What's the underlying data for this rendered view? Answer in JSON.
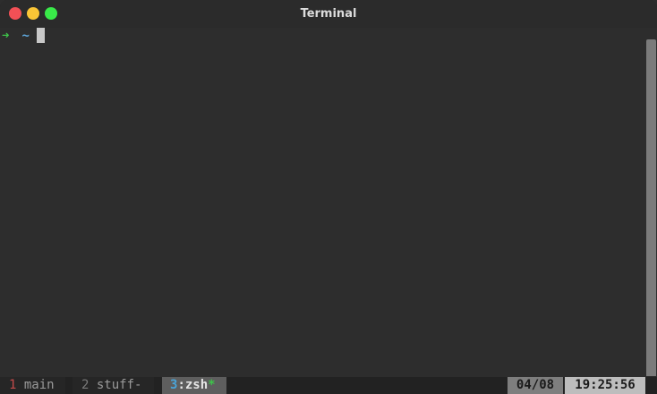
{
  "window": {
    "title": "Terminal"
  },
  "terminal": {
    "prompt_arrow": "➜",
    "prompt_dir": "~"
  },
  "statusbar": {
    "windows": [
      {
        "index": "1",
        "name": " main",
        "flag": ""
      },
      {
        "index": "2",
        "name": " stuff-",
        "flag": ""
      },
      {
        "index": "3",
        "name": ":zsh",
        "flag": "*"
      }
    ],
    "date": "04/08",
    "time": "19:25:56"
  },
  "colors": {
    "background": "#2d2d2d",
    "prompt_arrow": "#3ec34a",
    "prompt_dir": "#5fa8dd",
    "close": "#f25056",
    "minimize": "#fac536",
    "maximize": "#39ea49"
  }
}
